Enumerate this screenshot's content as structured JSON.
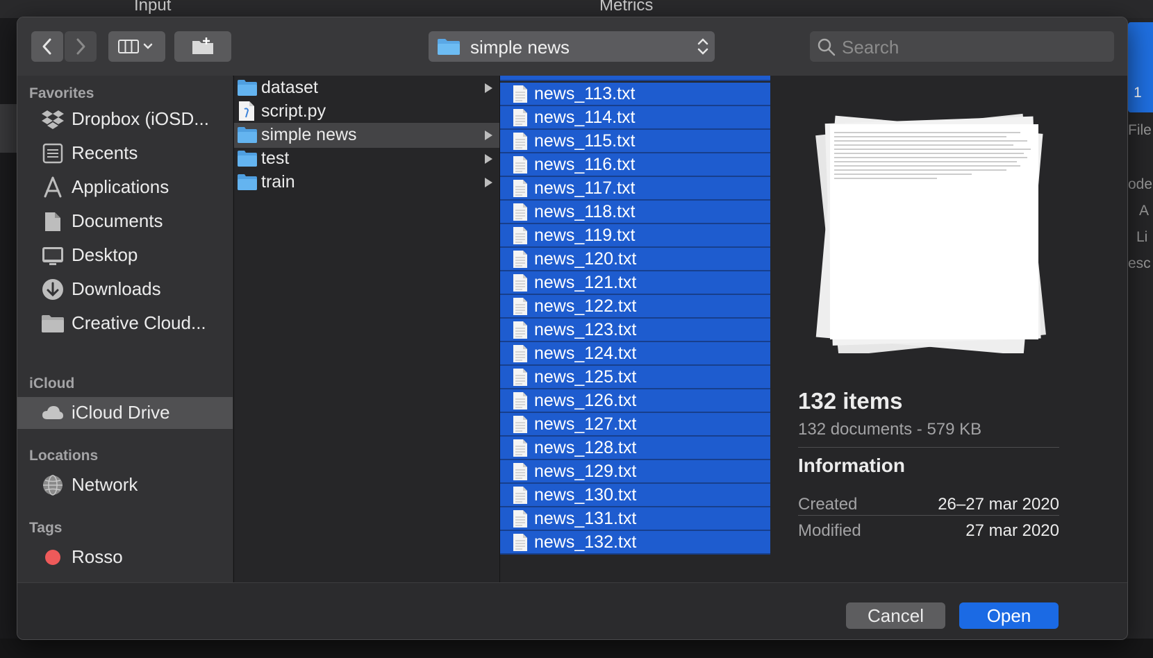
{
  "background": {
    "top_labels": [
      "Input",
      "Metrics"
    ],
    "right_labels": [
      "1",
      "File",
      "odel",
      "A",
      "Li",
      "esc"
    ]
  },
  "toolbar": {
    "back_icon": "chevron-left-icon",
    "forward_icon": "chevron-right-icon",
    "view_icon": "columns-view-icon",
    "new_folder_icon": "new-folder-icon",
    "path_label": "simple news",
    "search_placeholder": "Search"
  },
  "sidebar": {
    "favorites_label": "Favorites",
    "favorites": [
      {
        "label": "Dropbox (iOSD...",
        "icon": "dropbox-icon"
      },
      {
        "label": "Recents",
        "icon": "recents-icon"
      },
      {
        "label": "Applications",
        "icon": "applications-icon"
      },
      {
        "label": "Documents",
        "icon": "documents-icon"
      },
      {
        "label": "Desktop",
        "icon": "desktop-icon"
      },
      {
        "label": "Downloads",
        "icon": "downloads-icon"
      },
      {
        "label": "Creative Cloud...",
        "icon": "folder-icon"
      }
    ],
    "icloud_label": "iCloud",
    "icloud_drive": "iCloud Drive",
    "locations_label": "Locations",
    "network": "Network",
    "tags_label": "Tags",
    "tag_rosso": "Rosso",
    "tag_color": "#ee5a5a"
  },
  "column1": [
    {
      "label": "dataset",
      "type": "folder",
      "arrow": true
    },
    {
      "label": "script.py",
      "type": "file",
      "arrow": false
    },
    {
      "label": "simple news",
      "type": "folder",
      "arrow": true,
      "selected": true
    },
    {
      "label": "test",
      "type": "folder",
      "arrow": true
    },
    {
      "label": "train",
      "type": "folder",
      "arrow": true
    }
  ],
  "column2": [
    "news_113.txt",
    "news_114.txt",
    "news_115.txt",
    "news_116.txt",
    "news_117.txt",
    "news_118.txt",
    "news_119.txt",
    "news_120.txt",
    "news_121.txt",
    "news_122.txt",
    "news_123.txt",
    "news_124.txt",
    "news_125.txt",
    "news_126.txt",
    "news_127.txt",
    "news_128.txt",
    "news_129.txt",
    "news_130.txt",
    "news_131.txt",
    "news_132.txt"
  ],
  "preview": {
    "title": "132 items",
    "subtitle": "132 documents - 579 KB",
    "info_heading": "Information",
    "created_label": "Created",
    "created_value": "26–27 mar 2020",
    "modified_label": "Modified",
    "modified_value": "27 mar 2020"
  },
  "footer": {
    "cancel": "Cancel",
    "open": "Open"
  },
  "colors": {
    "selection_blue": "#1e5ccf",
    "open_button": "#1b6ae4"
  }
}
